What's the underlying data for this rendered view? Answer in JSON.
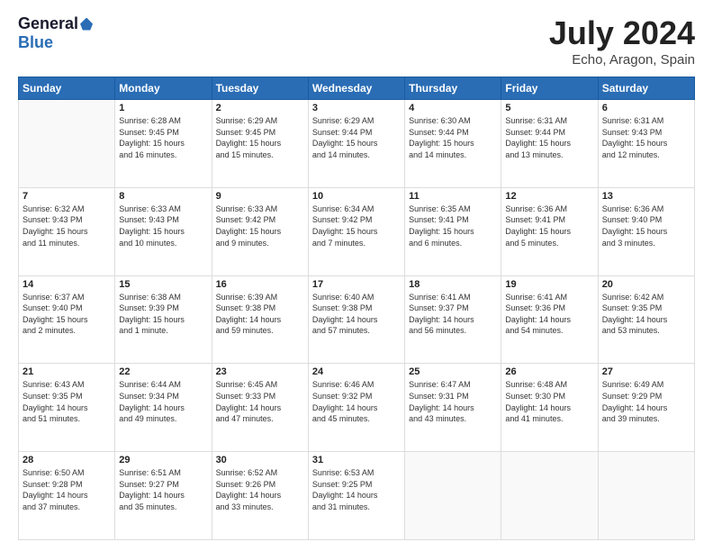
{
  "logo": {
    "general": "General",
    "blue": "Blue"
  },
  "title": "July 2024",
  "subtitle": "Echo, Aragon, Spain",
  "days_of_week": [
    "Sunday",
    "Monday",
    "Tuesday",
    "Wednesday",
    "Thursday",
    "Friday",
    "Saturday"
  ],
  "weeks": [
    [
      {
        "day": "",
        "info": ""
      },
      {
        "day": "1",
        "info": "Sunrise: 6:28 AM\nSunset: 9:45 PM\nDaylight: 15 hours\nand 16 minutes."
      },
      {
        "day": "2",
        "info": "Sunrise: 6:29 AM\nSunset: 9:45 PM\nDaylight: 15 hours\nand 15 minutes."
      },
      {
        "day": "3",
        "info": "Sunrise: 6:29 AM\nSunset: 9:44 PM\nDaylight: 15 hours\nand 14 minutes."
      },
      {
        "day": "4",
        "info": "Sunrise: 6:30 AM\nSunset: 9:44 PM\nDaylight: 15 hours\nand 14 minutes."
      },
      {
        "day": "5",
        "info": "Sunrise: 6:31 AM\nSunset: 9:44 PM\nDaylight: 15 hours\nand 13 minutes."
      },
      {
        "day": "6",
        "info": "Sunrise: 6:31 AM\nSunset: 9:43 PM\nDaylight: 15 hours\nand 12 minutes."
      }
    ],
    [
      {
        "day": "7",
        "info": "Sunrise: 6:32 AM\nSunset: 9:43 PM\nDaylight: 15 hours\nand 11 minutes."
      },
      {
        "day": "8",
        "info": "Sunrise: 6:33 AM\nSunset: 9:43 PM\nDaylight: 15 hours\nand 10 minutes."
      },
      {
        "day": "9",
        "info": "Sunrise: 6:33 AM\nSunset: 9:42 PM\nDaylight: 15 hours\nand 9 minutes."
      },
      {
        "day": "10",
        "info": "Sunrise: 6:34 AM\nSunset: 9:42 PM\nDaylight: 15 hours\nand 7 minutes."
      },
      {
        "day": "11",
        "info": "Sunrise: 6:35 AM\nSunset: 9:41 PM\nDaylight: 15 hours\nand 6 minutes."
      },
      {
        "day": "12",
        "info": "Sunrise: 6:36 AM\nSunset: 9:41 PM\nDaylight: 15 hours\nand 5 minutes."
      },
      {
        "day": "13",
        "info": "Sunrise: 6:36 AM\nSunset: 9:40 PM\nDaylight: 15 hours\nand 3 minutes."
      }
    ],
    [
      {
        "day": "14",
        "info": "Sunrise: 6:37 AM\nSunset: 9:40 PM\nDaylight: 15 hours\nand 2 minutes."
      },
      {
        "day": "15",
        "info": "Sunrise: 6:38 AM\nSunset: 9:39 PM\nDaylight: 15 hours\nand 1 minute."
      },
      {
        "day": "16",
        "info": "Sunrise: 6:39 AM\nSunset: 9:38 PM\nDaylight: 14 hours\nand 59 minutes."
      },
      {
        "day": "17",
        "info": "Sunrise: 6:40 AM\nSunset: 9:38 PM\nDaylight: 14 hours\nand 57 minutes."
      },
      {
        "day": "18",
        "info": "Sunrise: 6:41 AM\nSunset: 9:37 PM\nDaylight: 14 hours\nand 56 minutes."
      },
      {
        "day": "19",
        "info": "Sunrise: 6:41 AM\nSunset: 9:36 PM\nDaylight: 14 hours\nand 54 minutes."
      },
      {
        "day": "20",
        "info": "Sunrise: 6:42 AM\nSunset: 9:35 PM\nDaylight: 14 hours\nand 53 minutes."
      }
    ],
    [
      {
        "day": "21",
        "info": "Sunrise: 6:43 AM\nSunset: 9:35 PM\nDaylight: 14 hours\nand 51 minutes."
      },
      {
        "day": "22",
        "info": "Sunrise: 6:44 AM\nSunset: 9:34 PM\nDaylight: 14 hours\nand 49 minutes."
      },
      {
        "day": "23",
        "info": "Sunrise: 6:45 AM\nSunset: 9:33 PM\nDaylight: 14 hours\nand 47 minutes."
      },
      {
        "day": "24",
        "info": "Sunrise: 6:46 AM\nSunset: 9:32 PM\nDaylight: 14 hours\nand 45 minutes."
      },
      {
        "day": "25",
        "info": "Sunrise: 6:47 AM\nSunset: 9:31 PM\nDaylight: 14 hours\nand 43 minutes."
      },
      {
        "day": "26",
        "info": "Sunrise: 6:48 AM\nSunset: 9:30 PM\nDaylight: 14 hours\nand 41 minutes."
      },
      {
        "day": "27",
        "info": "Sunrise: 6:49 AM\nSunset: 9:29 PM\nDaylight: 14 hours\nand 39 minutes."
      }
    ],
    [
      {
        "day": "28",
        "info": "Sunrise: 6:50 AM\nSunset: 9:28 PM\nDaylight: 14 hours\nand 37 minutes."
      },
      {
        "day": "29",
        "info": "Sunrise: 6:51 AM\nSunset: 9:27 PM\nDaylight: 14 hours\nand 35 minutes."
      },
      {
        "day": "30",
        "info": "Sunrise: 6:52 AM\nSunset: 9:26 PM\nDaylight: 14 hours\nand 33 minutes."
      },
      {
        "day": "31",
        "info": "Sunrise: 6:53 AM\nSunset: 9:25 PM\nDaylight: 14 hours\nand 31 minutes."
      },
      {
        "day": "",
        "info": ""
      },
      {
        "day": "",
        "info": ""
      },
      {
        "day": "",
        "info": ""
      }
    ]
  ]
}
